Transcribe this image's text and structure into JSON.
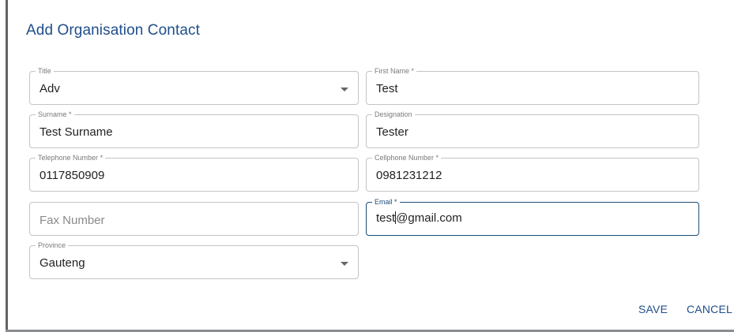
{
  "dialog": {
    "title": "Add Organisation Contact"
  },
  "fields": {
    "title": {
      "label": "Title",
      "value": "Adv"
    },
    "first_name": {
      "label": "First Name *",
      "value": "Test"
    },
    "surname": {
      "label": "Surname *",
      "value": "Test Surname"
    },
    "designation": {
      "label": "Designation",
      "value": "Tester"
    },
    "telephone": {
      "label": "Telephone Number *",
      "value": "0117850909"
    },
    "cellphone": {
      "label": "Cellphone Number *",
      "value": "0981231212"
    },
    "fax": {
      "placeholder": "Fax Number"
    },
    "email": {
      "label": "Email *",
      "value_before_cursor": "test",
      "value_after_cursor": "@gmail.com"
    },
    "province": {
      "label": "Province",
      "value": "Gauteng"
    }
  },
  "actions": {
    "save_label": "SAVE",
    "cancel_label": "CANCEL"
  },
  "colors": {
    "accent": "#1f4e8c",
    "border": "#c4c4c4",
    "focus_border": "#1f4e79"
  }
}
